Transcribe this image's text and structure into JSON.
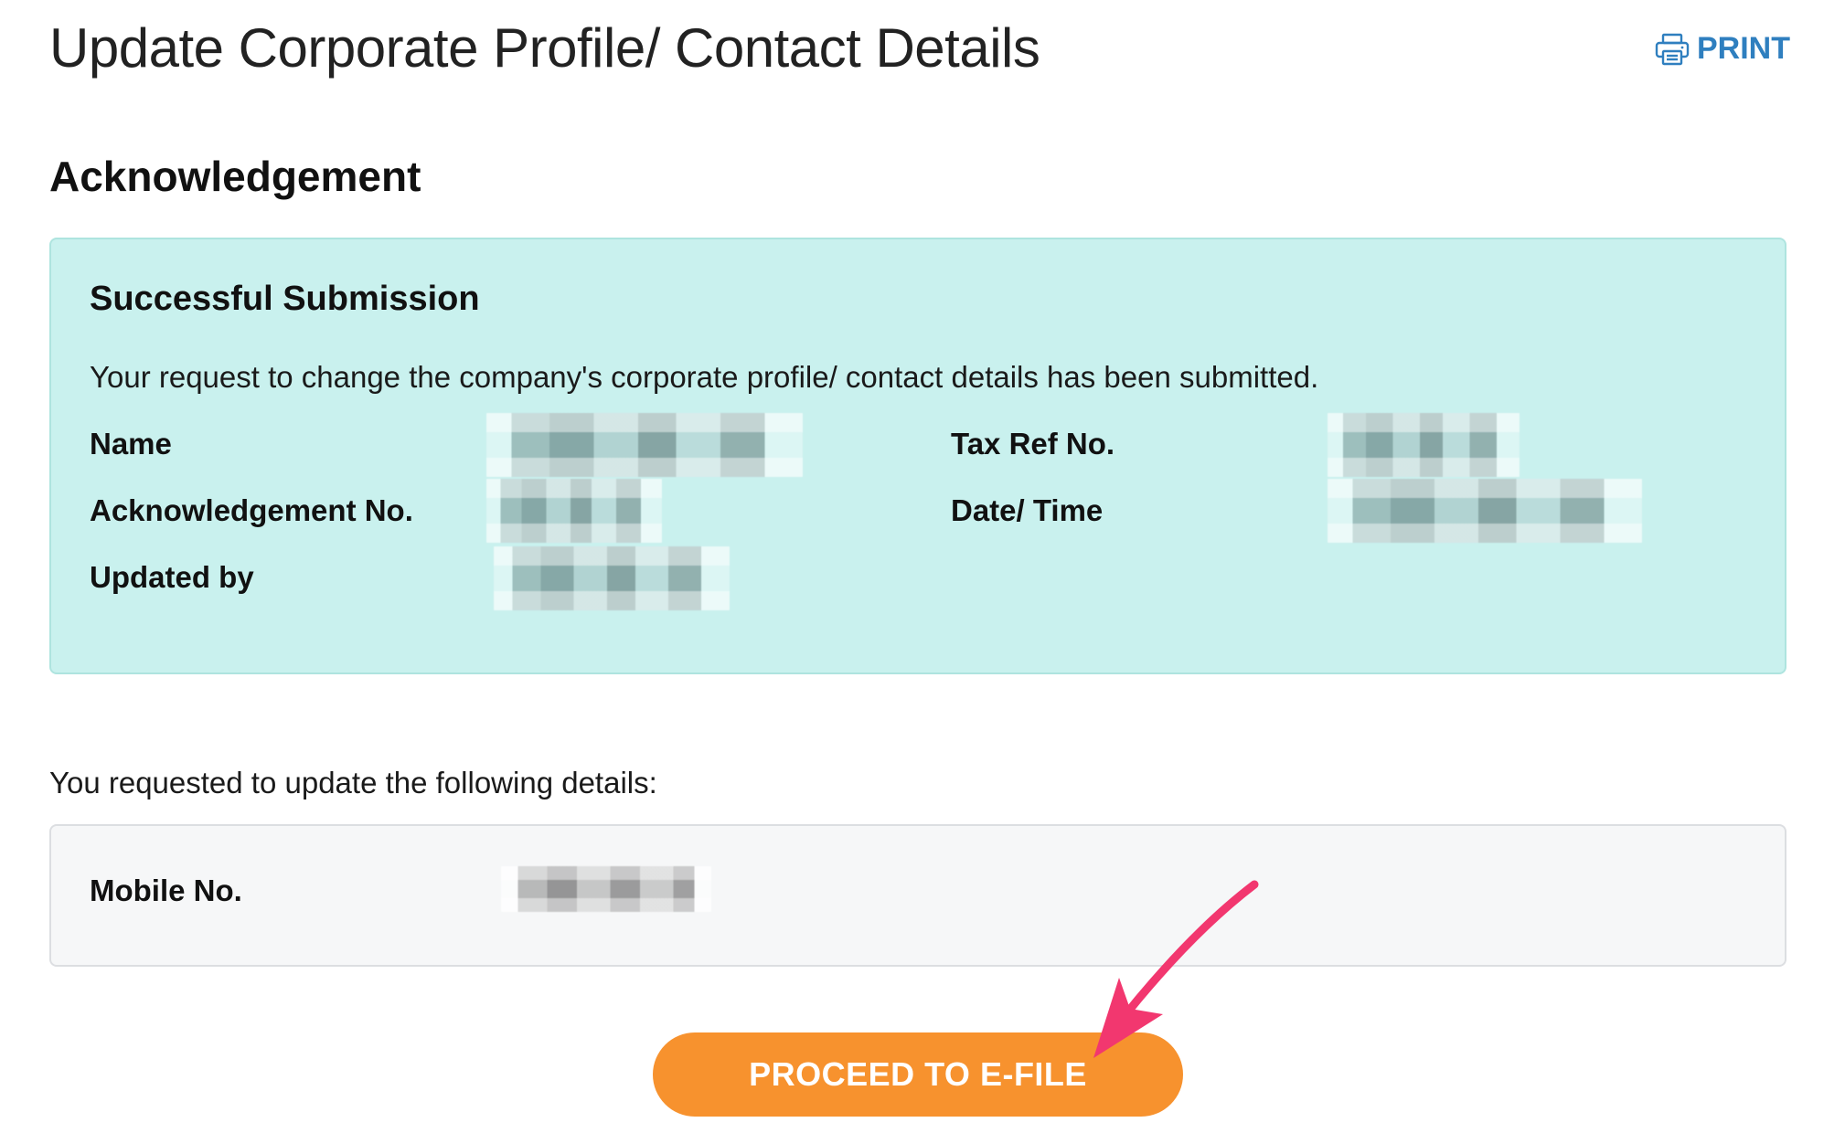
{
  "header": {
    "title": "Update Corporate Profile/ Contact Details",
    "print_label": "PRINT",
    "print_icon": "printer-icon"
  },
  "acknowledgement": {
    "heading": "Acknowledgement",
    "box_title": "Successful Submission",
    "message": "Your request to change the company's corporate profile/ contact details has been submitted.",
    "fields": {
      "name_label": "Name",
      "tax_ref_label": "Tax Ref No.",
      "ack_no_label": "Acknowledgement No.",
      "date_time_label": "Date/ Time",
      "updated_by_label": "Updated by"
    }
  },
  "details": {
    "intro": "You requested to update the following details:",
    "mobile_label": "Mobile No."
  },
  "actions": {
    "proceed_label": "PROCEED TO E-FILE"
  },
  "colors": {
    "accent_link": "#2f7fbf",
    "success_bg": "#c9f1ee",
    "button_bg": "#f7922e",
    "annotation_arrow": "#f2376f"
  }
}
